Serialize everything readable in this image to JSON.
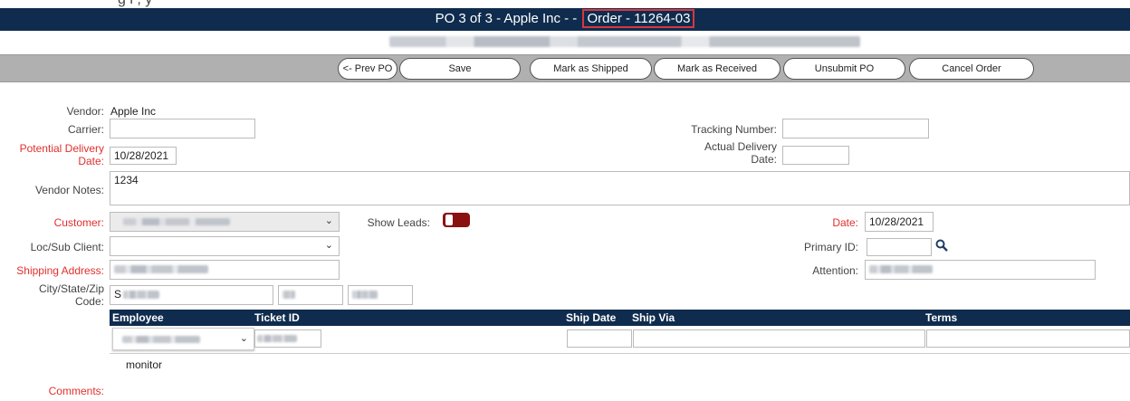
{
  "top_fragment": "g i                                              ,           y",
  "header": {
    "title": "PO 3 of 3 - Apple Inc - -",
    "order": "Order - 11264-03"
  },
  "toolbar": {
    "prev": "<- Prev PO",
    "save": "Save",
    "shipped": "Mark as Shipped",
    "received": "Mark as Received",
    "unsubmit": "Unsubmit PO",
    "cancel": "Cancel Order"
  },
  "form": {
    "vendor_label": "Vendor:",
    "vendor_value": "Apple Inc",
    "carrier_label": "Carrier:",
    "carrier_value": "",
    "tracking_label": "Tracking Number:",
    "tracking_value": "",
    "potential_delivery_label_1": "Potential Delivery",
    "potential_delivery_label_2": "Date:",
    "potential_delivery_value": "10/28/2021",
    "actual_delivery_label_1": "Actual Delivery",
    "actual_delivery_label_2": "Date:",
    "actual_delivery_value": "",
    "vendor_notes_label": "Vendor Notes:",
    "vendor_notes_value": "1234",
    "customer_label": "Customer:",
    "show_leads_label": "Show Leads:",
    "date_label": "Date:",
    "date_value": "10/28/2021",
    "loc_label": "Loc/Sub Client:",
    "primary_id_label": "Primary ID:",
    "primary_id_value": "",
    "shipping_label": "Shipping Address:",
    "attention_label": "Attention:",
    "city_label_1": "City/State/Zip",
    "city_label_2": "Code:",
    "city_prefix": "S",
    "comments_label": "Comments:",
    "comments_value": "monitor"
  },
  "grid": {
    "columns": [
      "Employee",
      "Ticket ID",
      "Ship Date",
      "Ship Via",
      "Terms"
    ]
  },
  "icons": {
    "search": "search-icon",
    "chevron": "chevron-down-icon"
  },
  "colors": {
    "header_bg": "#0f2c4e",
    "highlight_border": "#d9363e",
    "required_label": "#e0302e",
    "toggle": "#8b1111"
  }
}
